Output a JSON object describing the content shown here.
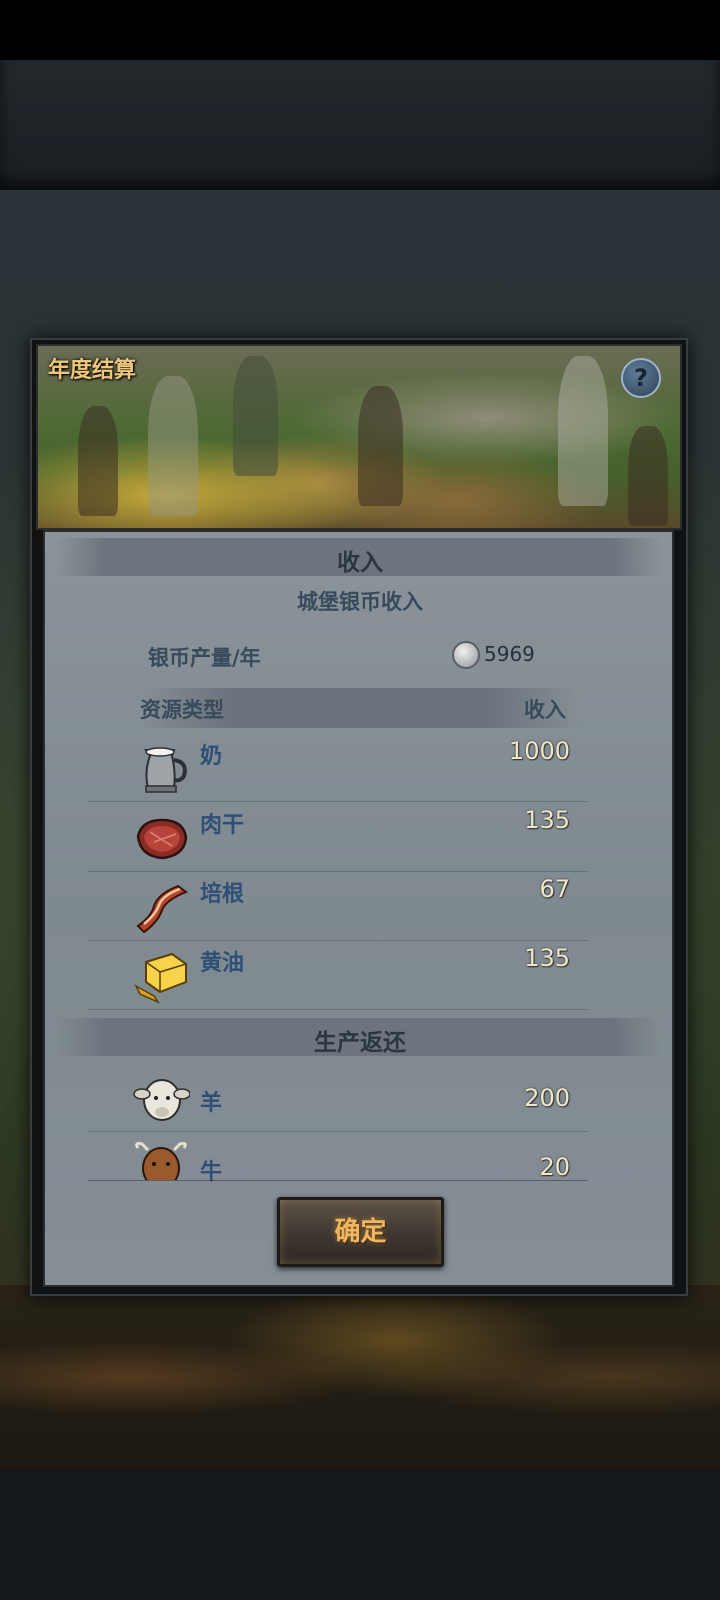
{
  "dialog": {
    "title": "年度结算",
    "help_label": "?",
    "income_header": "收入",
    "castle_silver_income": "城堡银币收入",
    "silver_per_year_label": "银币产量/年",
    "silver_per_year_value": "5969",
    "col_resource_type": "资源类型",
    "col_income": "收入",
    "income_items": [
      {
        "name": "奶",
        "value": "1000",
        "icon": "milk-pitcher-icon"
      },
      {
        "name": "肉干",
        "value": "135",
        "icon": "jerky-meat-icon"
      },
      {
        "name": "培根",
        "value": "67",
        "icon": "bacon-icon"
      },
      {
        "name": "黄油",
        "value": "135",
        "icon": "butter-icon"
      }
    ],
    "production_return_header": "生产返还",
    "return_items": [
      {
        "name": "羊",
        "value": "200",
        "icon": "sheep-icon"
      },
      {
        "name": "牛",
        "value": "20",
        "icon": "cow-icon"
      }
    ],
    "confirm_label": "确定"
  },
  "colors": {
    "title": "#f0c77a",
    "item_name": "#2f4f76",
    "item_value": "#ede7c8",
    "button_text": "#f2b65e",
    "panel": "#858e95"
  }
}
